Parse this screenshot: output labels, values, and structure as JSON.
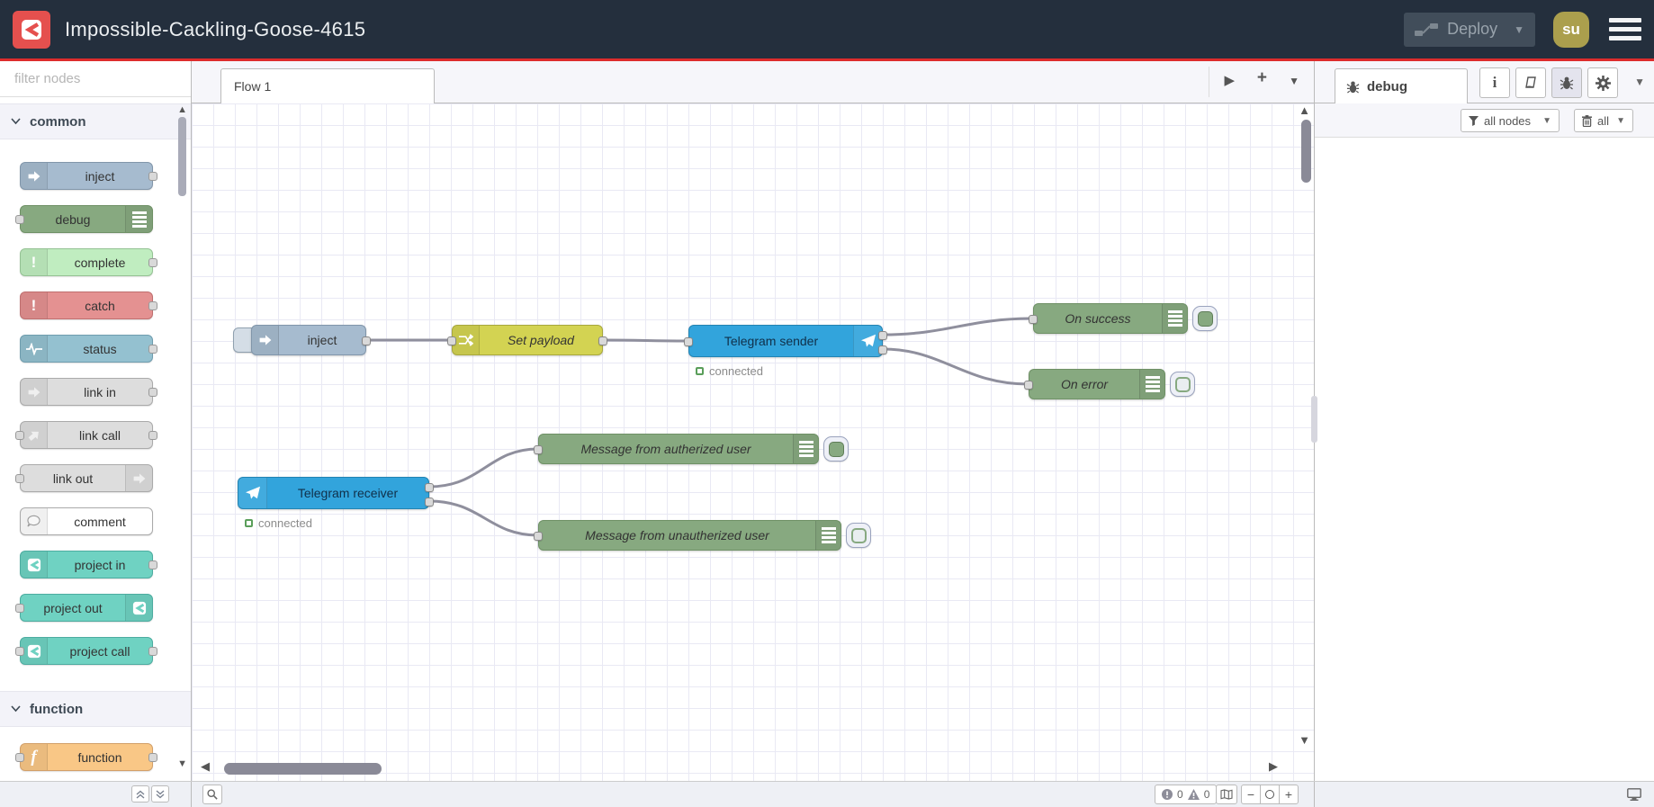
{
  "header": {
    "title": "Impossible-Cackling-Goose-4615",
    "deploy": {
      "label": "Deploy"
    },
    "user": {
      "initials": "su"
    }
  },
  "colors": {
    "header_bg": "#242f3d",
    "accent_red": "#dd2c2c",
    "logo_red": "#e5504e",
    "wire": "#8f8f9d",
    "grid_line": "#e9e9f4",
    "status_green": "#5a9e5a"
  },
  "palette": {
    "filter_placeholder": "filter nodes",
    "categories": [
      {
        "label": "common",
        "nodes": [
          {
            "label": "inject",
            "color": "#a6bbcf",
            "border": "#8196aa"
          },
          {
            "label": "debug",
            "color": "#87a980",
            "border": "#6f9166"
          },
          {
            "label": "complete",
            "color": "#c0edc0",
            "border": "#95c294"
          },
          {
            "label": "catch",
            "color": "#e49191",
            "border": "#bf6f6f"
          },
          {
            "label": "status",
            "color": "#94c1d0",
            "border": "#6f9dae"
          },
          {
            "label": "link in",
            "color": "#dddddd",
            "border": "#aaaaaa"
          },
          {
            "label": "link call",
            "color": "#dddddd",
            "border": "#aaaaaa"
          },
          {
            "label": "link out",
            "color": "#dddddd",
            "border": "#aaaaaa"
          },
          {
            "label": "comment",
            "color": "#ffffff",
            "border": "#aaaaaa"
          },
          {
            "label": "project in",
            "color": "#6fd2c2",
            "border": "#4daca0"
          },
          {
            "label": "project out",
            "color": "#6fd2c2",
            "border": "#4daca0"
          },
          {
            "label": "project call",
            "color": "#6fd2c2",
            "border": "#4daca0"
          }
        ]
      },
      {
        "label": "function",
        "nodes": [
          {
            "label": "function",
            "color": "#f9c786",
            "border": "#d2a06a"
          }
        ]
      }
    ]
  },
  "workspace": {
    "tab": {
      "label": "Flow 1"
    },
    "flow": {
      "nodes": [
        {
          "label": "inject",
          "color": "#a6bbcf",
          "border": "#8196aa"
        },
        {
          "label": "Set payload",
          "color": "#d3d352",
          "border": "#a8a83d"
        },
        {
          "label": "Telegram sender",
          "color": "#32a4dc",
          "border": "#2383b2",
          "status": "connected"
        },
        {
          "label": "On success",
          "color": "#87a980",
          "border": "#6f9166",
          "enabled": true
        },
        {
          "label": "On error",
          "color": "#87a980",
          "border": "#6f9166",
          "enabled": false
        },
        {
          "label": "Telegram receiver",
          "color": "#32a4dc",
          "border": "#2383b2",
          "status": "connected"
        },
        {
          "label": "Message from autherized user",
          "color": "#87a980",
          "border": "#6f9166",
          "enabled": true
        },
        {
          "label": "Message from unautherized user",
          "color": "#87a980",
          "border": "#6f9166",
          "enabled": false
        }
      ]
    },
    "footer": {
      "error_count": "0",
      "warning_count": "0"
    }
  },
  "sidebar": {
    "tab_label": "debug",
    "filter_button_label": "all nodes",
    "clear_button_label": "all"
  }
}
